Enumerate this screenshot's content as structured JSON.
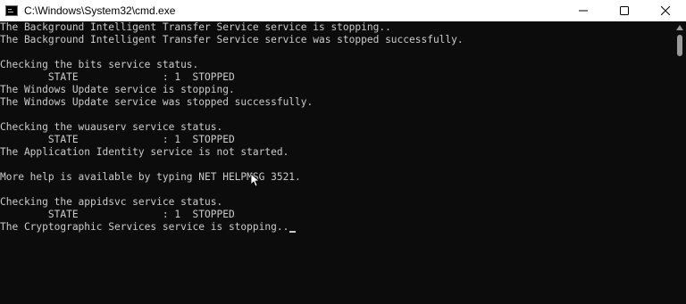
{
  "window": {
    "title": "C:\\Windows\\System32\\cmd.exe",
    "icon": "cmd-icon",
    "controls": [
      "minimize-icon",
      "maximize-icon",
      "close-icon"
    ]
  },
  "console": {
    "lines": [
      "The Background Intelligent Transfer Service service is stopping..",
      "The Background Intelligent Transfer Service service was stopped successfully.",
      "",
      "Checking the bits service status.",
      "        STATE              : 1  STOPPED",
      "The Windows Update service is stopping.",
      "The Windows Update service was stopped successfully.",
      "",
      "Checking the wuauserv service status.",
      "        STATE              : 1  STOPPED",
      "The Application Identity service is not started.",
      "",
      "More help is available by typing NET HELPMSG 3521.",
      "",
      "Checking the appidsvc service status.",
      "        STATE              : 1  STOPPED",
      "The Cryptographic Services service is stopping.."
    ]
  },
  "colors": {
    "background": "#0c0c0c",
    "text": "#cccccc",
    "titlebar": "#ffffff"
  }
}
